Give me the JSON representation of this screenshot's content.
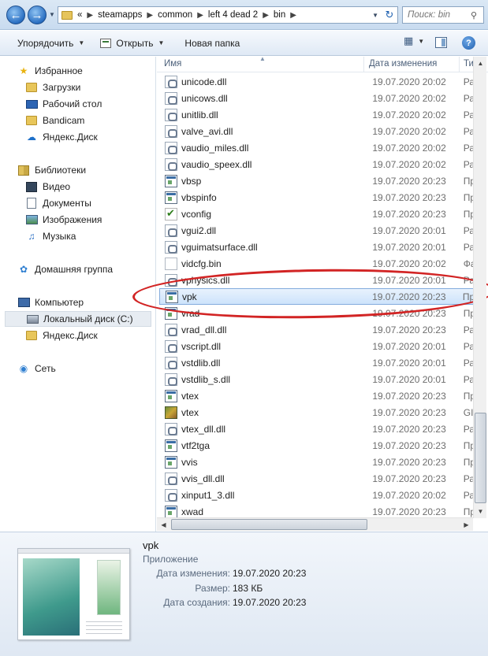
{
  "address_bar": {
    "overflow": "«",
    "crumbs": [
      "steamapps",
      "common",
      "left 4 dead 2",
      "bin"
    ],
    "search_placeholder": "Поиск: bin"
  },
  "toolbar": {
    "organize": "Упорядочить",
    "open": "Открыть",
    "new_folder": "Новая папка"
  },
  "nav": {
    "favorites": "Избранное",
    "downloads": "Загрузки",
    "desktop": "Рабочий стол",
    "bandicam": "Bandicam",
    "yandex_disk": "Яндекс.Диск",
    "libraries": "Библиотеки",
    "video": "Видео",
    "documents": "Документы",
    "images": "Изображения",
    "music": "Музыка",
    "homegroup": "Домашняя группа",
    "computer": "Компьютер",
    "local_disk": "Локальный диск (C:)",
    "yandex_disk_2": "Яндекс.Диск",
    "network": "Сеть"
  },
  "columns": {
    "name": "Имя",
    "date": "Дата изменения",
    "type": "Ти"
  },
  "files": [
    {
      "name": "unicode.dll",
      "date": "19.07.2020 20:02",
      "type": "Ра",
      "icon": "dll-icon"
    },
    {
      "name": "unicows.dll",
      "date": "19.07.2020 20:02",
      "type": "Ра",
      "icon": "dll-icon"
    },
    {
      "name": "unitlib.dll",
      "date": "19.07.2020 20:02",
      "type": "Ра",
      "icon": "dll-icon"
    },
    {
      "name": "valve_avi.dll",
      "date": "19.07.2020 20:02",
      "type": "Ра",
      "icon": "dll-icon"
    },
    {
      "name": "vaudio_miles.dll",
      "date": "19.07.2020 20:02",
      "type": "Ра",
      "icon": "dll-icon"
    },
    {
      "name": "vaudio_speex.dll",
      "date": "19.07.2020 20:02",
      "type": "Ра",
      "icon": "dll-icon"
    },
    {
      "name": "vbsp",
      "date": "19.07.2020 20:23",
      "type": "Пр",
      "icon": "exe-icon"
    },
    {
      "name": "vbspinfo",
      "date": "19.07.2020 20:23",
      "type": "Пр",
      "icon": "exe-icon"
    },
    {
      "name": "vconfig",
      "date": "19.07.2020 20:23",
      "type": "Пр",
      "icon": "checkmark-icon"
    },
    {
      "name": "vgui2.dll",
      "date": "19.07.2020 20:01",
      "type": "Ра",
      "icon": "dll-icon"
    },
    {
      "name": "vguimatsurface.dll",
      "date": "19.07.2020 20:01",
      "type": "Ра",
      "icon": "dll-icon"
    },
    {
      "name": "vidcfg.bin",
      "date": "19.07.2020 20:02",
      "type": "Фа",
      "icon": "bin-file-icon"
    },
    {
      "name": "vphysics.dll",
      "date": "19.07.2020 20:01",
      "type": "Ра",
      "icon": "dll-icon"
    },
    {
      "name": "vpk",
      "date": "19.07.2020 20:23",
      "type": "Пр",
      "icon": "exe-icon",
      "selected": true
    },
    {
      "name": "vrad",
      "date": "19.07.2020 20:23",
      "type": "Пр",
      "icon": "exe-icon"
    },
    {
      "name": "vrad_dll.dll",
      "date": "19.07.2020 20:23",
      "type": "Ра",
      "icon": "dll-icon"
    },
    {
      "name": "vscript.dll",
      "date": "19.07.2020 20:01",
      "type": "Ра",
      "icon": "dll-icon"
    },
    {
      "name": "vstdlib.dll",
      "date": "19.07.2020 20:01",
      "type": "Ра",
      "icon": "dll-icon"
    },
    {
      "name": "vstdlib_s.dll",
      "date": "19.07.2020 20:01",
      "type": "Ра",
      "icon": "dll-icon"
    },
    {
      "name": "vtex",
      "date": "19.07.2020 20:23",
      "type": "Пр",
      "icon": "exe-icon"
    },
    {
      "name": "vtex",
      "date": "19.07.2020 20:23",
      "type": "GI",
      "icon": "gif-image-icon"
    },
    {
      "name": "vtex_dll.dll",
      "date": "19.07.2020 20:23",
      "type": "Ра",
      "icon": "dll-icon"
    },
    {
      "name": "vtf2tga",
      "date": "19.07.2020 20:23",
      "type": "Пр",
      "icon": "exe-icon"
    },
    {
      "name": "vvis",
      "date": "19.07.2020 20:23",
      "type": "Пр",
      "icon": "exe-icon"
    },
    {
      "name": "vvis_dll.dll",
      "date": "19.07.2020 20:23",
      "type": "Ра",
      "icon": "dll-icon"
    },
    {
      "name": "xinput1_3.dll",
      "date": "19.07.2020 20:02",
      "type": "Ра",
      "icon": "dll-icon"
    },
    {
      "name": "xwad",
      "date": "19.07.2020 20:23",
      "type": "Пр",
      "icon": "exe-icon"
    }
  ],
  "details": {
    "name": "vpk",
    "kind": "Приложение",
    "modified_label": "Дата изменения:",
    "modified_value": "19.07.2020 20:23",
    "size_label": "Размер:",
    "size_value": "183 КБ",
    "created_label": "Дата создания:",
    "created_value": "19.07.2020 20:23"
  },
  "colors": {
    "selection": "#cde3fb",
    "annotation_ring": "#d22424",
    "chrome": "#dbe8f5"
  }
}
